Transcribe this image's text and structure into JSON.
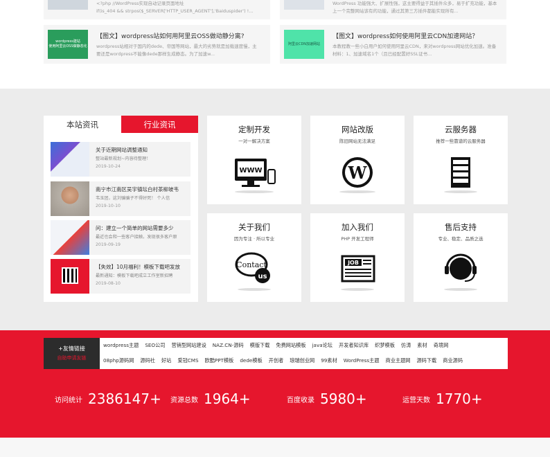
{
  "top_cards": [
    {
      "thumb": "",
      "title": "",
      "desc": "<?php //WordPress实现自动记录页面地址\nif(is_404 && strpos($_SERVER['HTTP_USER_AGENT'],'Baiduspider') !..."
    },
    {
      "thumb": "",
      "title": "",
      "desc": "WordPress 功能强大、扩展性强，这主要得益于其插件众多，易于扩充功能，基本\n上一个完整网站该有的功能，通过其第三方插件都能实现所有..."
    },
    {
      "thumb": "wordpress建站\n使用阿里云OSS做静态化",
      "title": "【图文】wordpress站如何用阿里云OSS做动静分离?",
      "desc": "wordpress站相对于国内的dede、帝国等网站，最大的劣势就是加载速度慢，主\n要还是wordpress不能像dede那样生成静态。为了加速w..."
    },
    {
      "thumb": "阿里云CDN加速网站",
      "title": "【图文】wordpress如何使用阿里云CDN加速网站？",
      "desc": "本教程教一些小白用户如何使用阿里云CDN，来对wordpress网站优化加速。准备\n材料：1、加速域名1个（且已经配置好SSL证书..."
    }
  ],
  "news": {
    "tab_active": "本站资讯",
    "tab_other": "行业资讯",
    "items": [
      {
        "title": "关于近期网站调整通知",
        "desc": "整站最新规划~内容待整理！",
        "date": "2019-10-24"
      },
      {
        "title": "南宁市江南区吴宇镇坛白村茶柳坡韦",
        "desc": "韦玉团，这刘骗骗子不得好死！ 个人信",
        "date": "2019-10-10"
      },
      {
        "title": "问：建立一个简单的网站需要多少",
        "desc": "最近也会和一些客户接触，发现很多客户原",
        "date": "2019-09-19"
      },
      {
        "title": "【失效】10月福利！模板下载吧发放",
        "desc": "最新通知：模板下载吧成立工作室新招聘",
        "date": "2019-08-10"
      }
    ]
  },
  "services": [
    {
      "title": "定制开发",
      "sub": "一对一解决方案",
      "icon": "www-computer-icon"
    },
    {
      "title": "网站改版",
      "sub": "陈旧网站无法满足",
      "icon": "wordpress-logo-icon"
    },
    {
      "title": "云服务器",
      "sub": "推荐一些靠谱的云服务器",
      "icon": "server-rack-icon"
    },
    {
      "title": "关于我们",
      "sub": "因为专注 · 所以专业",
      "icon": "contact-us-icon"
    },
    {
      "title": "加入我们",
      "sub": "PHP 开发工程师",
      "icon": "job-newspaper-icon"
    },
    {
      "title": "售后支持",
      "sub": "专业、稳定、品质之选",
      "icon": "headset-support-icon"
    }
  ],
  "links": {
    "head": "+友情链接",
    "apply": "自助申请友链",
    "row1": [
      "wordpress主题",
      "SEO公司",
      "营销型网站建设",
      "NAZ.CN-源码",
      "模版下载",
      "免费网站模板",
      "java论坛",
      "开发者知识库",
      "织梦模板",
      "仿涛",
      "素材",
      "奇境网"
    ],
    "row2": [
      "08php源码网",
      "源码社",
      "好站",
      "爱冠CMS",
      "欧酷PPT模板",
      "dede模板",
      "开创者",
      "琅瑞创业网",
      "99素材",
      "WordPress主题",
      "商业主题网",
      "源码下载",
      "商业源码"
    ]
  },
  "stats": [
    {
      "label": "访问统计",
      "value": "2386147+"
    },
    {
      "label": "资源总数",
      "value": "1964+"
    },
    {
      "label": "百度收录",
      "value": "5980+"
    },
    {
      "label": "运营天数",
      "value": "1770+"
    }
  ],
  "colors": {
    "accent": "#e6162d",
    "thumb_green": "#2a9d5c",
    "thumb_mint": "#4fe3a9"
  }
}
